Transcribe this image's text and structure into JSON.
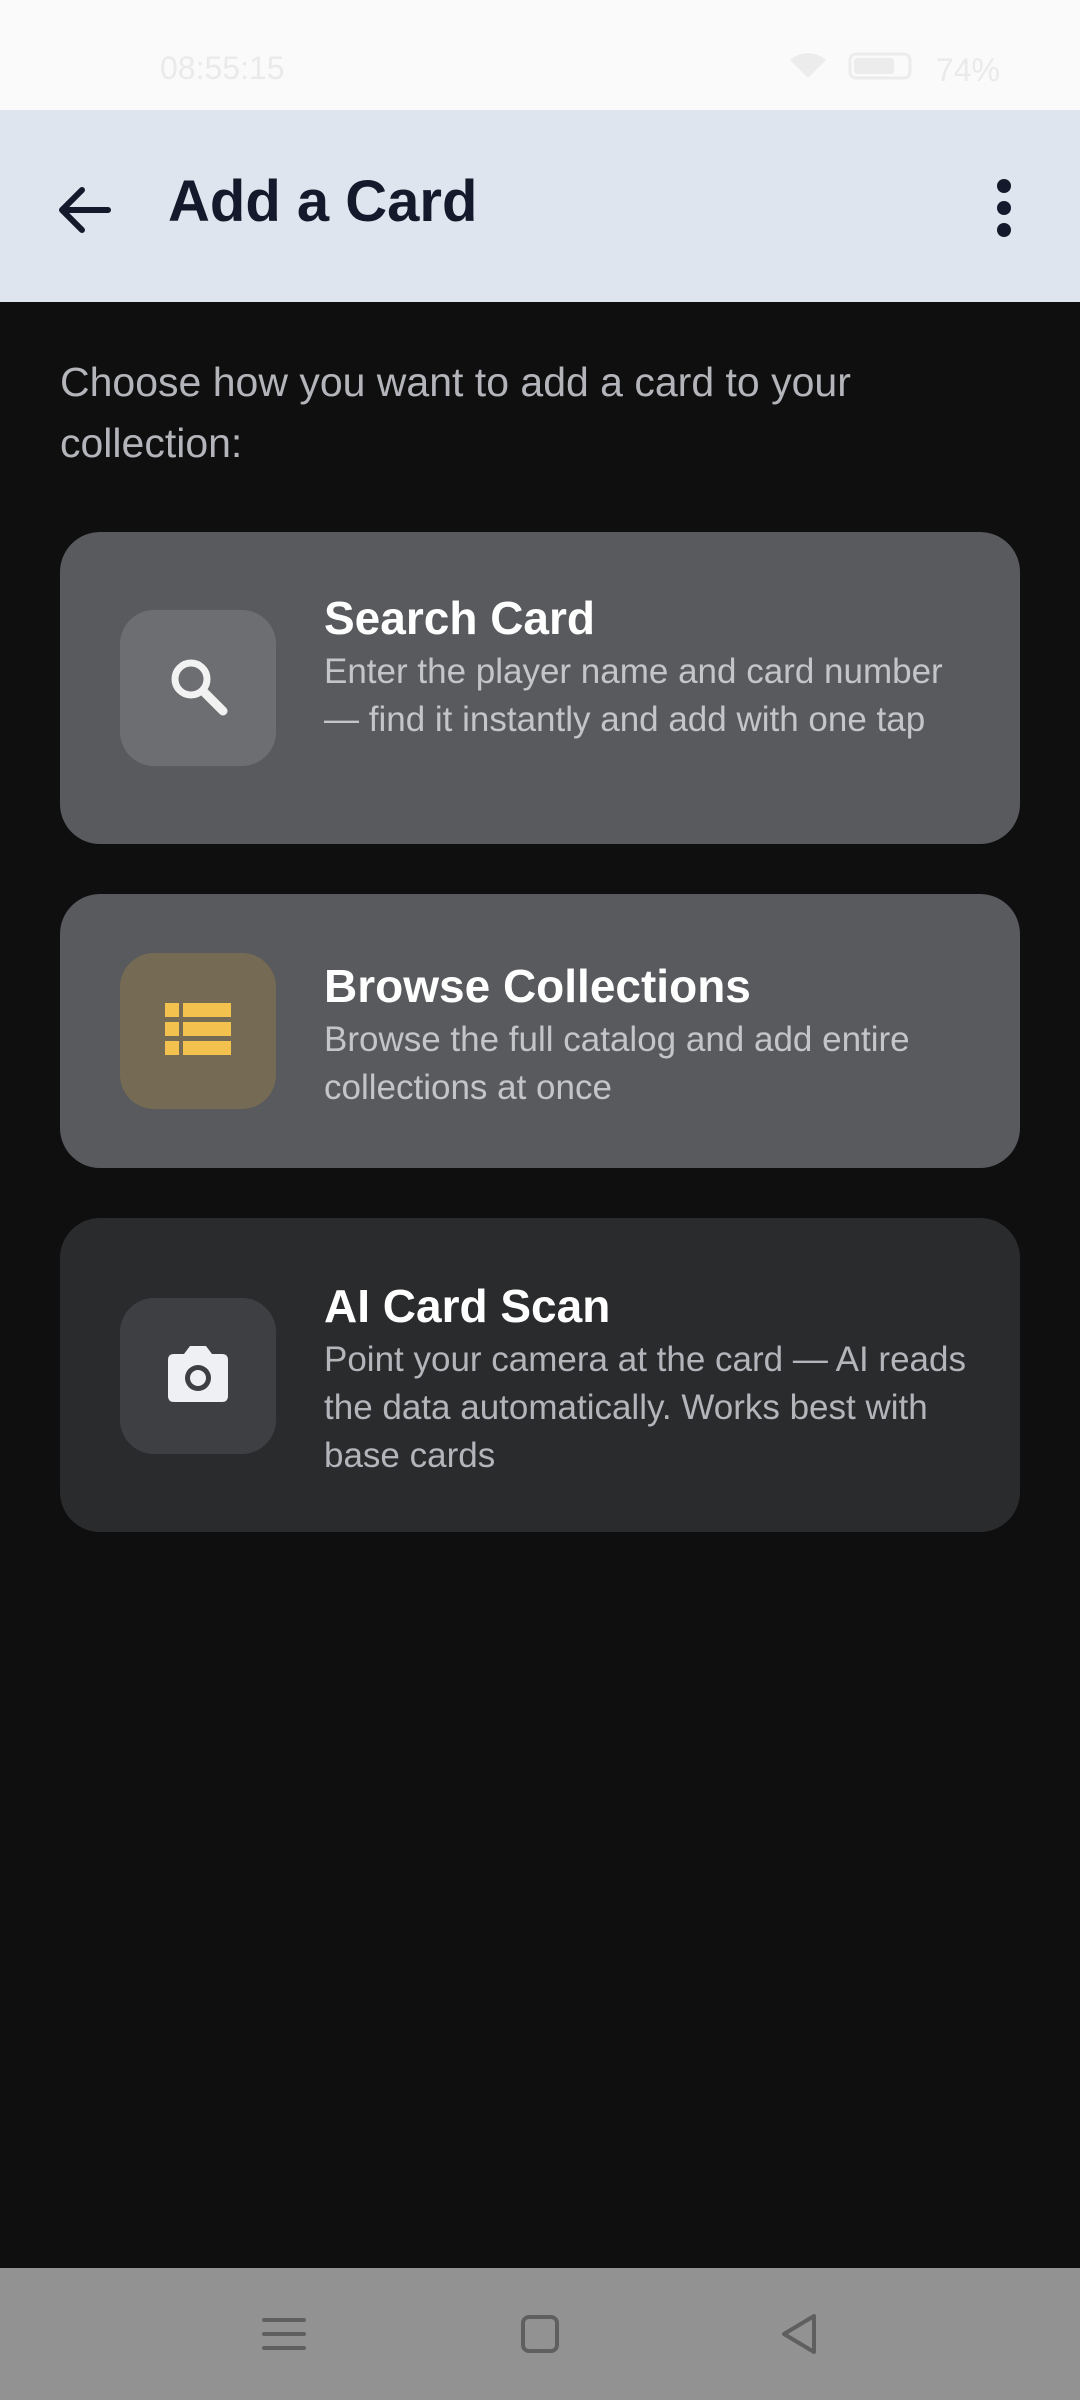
{
  "status_bar": {
    "time": "08:55:15",
    "battery": "74%"
  },
  "app_bar": {
    "title": "Add a Card",
    "back_icon": "arrow-left-icon",
    "more_icon": "more-vert-icon"
  },
  "intro": "Choose how you want to add a card to your collection:",
  "options": [
    {
      "title": "Search Card",
      "description": "Enter the player name and card number — find it instantly and add with one tap",
      "icon": "search-icon"
    },
    {
      "title": "Browse Collections",
      "description": "Browse the full catalog and add entire collections at once",
      "icon": "list-icon",
      "icon_color": "#f2c14e"
    },
    {
      "title": "AI Card Scan",
      "description": "Point your camera at the card — AI reads the data automatically. Works best with base cards",
      "icon": "camera-icon"
    }
  ],
  "nav_bar": {
    "menu_icon": "menu-icon",
    "home_icon": "home-square-icon",
    "back_icon": "back-triangle-icon"
  },
  "colors": {
    "app_bar_bg": "#dfe5ee",
    "background": "#0f0f0f",
    "accent_yellow": "#f2c14e"
  }
}
